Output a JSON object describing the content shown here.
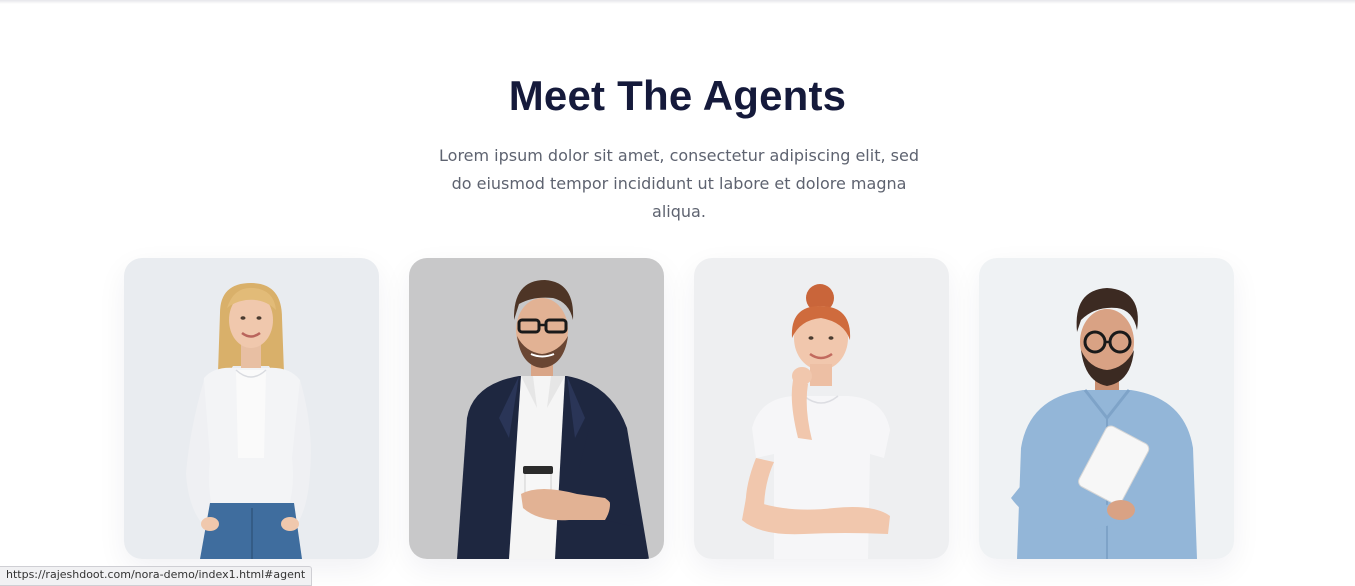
{
  "section": {
    "title": "Meet The Agents",
    "subtitle": "Lorem ipsum dolor sit amet, consectetur adipiscing elit, sed do eiusmod tempor incididunt ut labore et dolore magna aliqua."
  },
  "agents": [
    {
      "photo": "agent-photo-woman-white-cardigan"
    },
    {
      "photo": "agent-photo-man-navy-blazer-coffee"
    },
    {
      "photo": "agent-photo-woman-red-hair-white-tee"
    },
    {
      "photo": "agent-photo-man-denim-shirt-tablet"
    }
  ],
  "status_bar": {
    "url": "https://rajeshdoot.com/nora-demo/index1.html#agent"
  },
  "colors": {
    "title": "#151a3b",
    "text": "#5e6370",
    "card_bg_1": "#e9ecf0",
    "card_bg_2": "#c8c8c9",
    "card_bg_3": "#eeeff1",
    "card_bg_4": "#eff2f4"
  }
}
